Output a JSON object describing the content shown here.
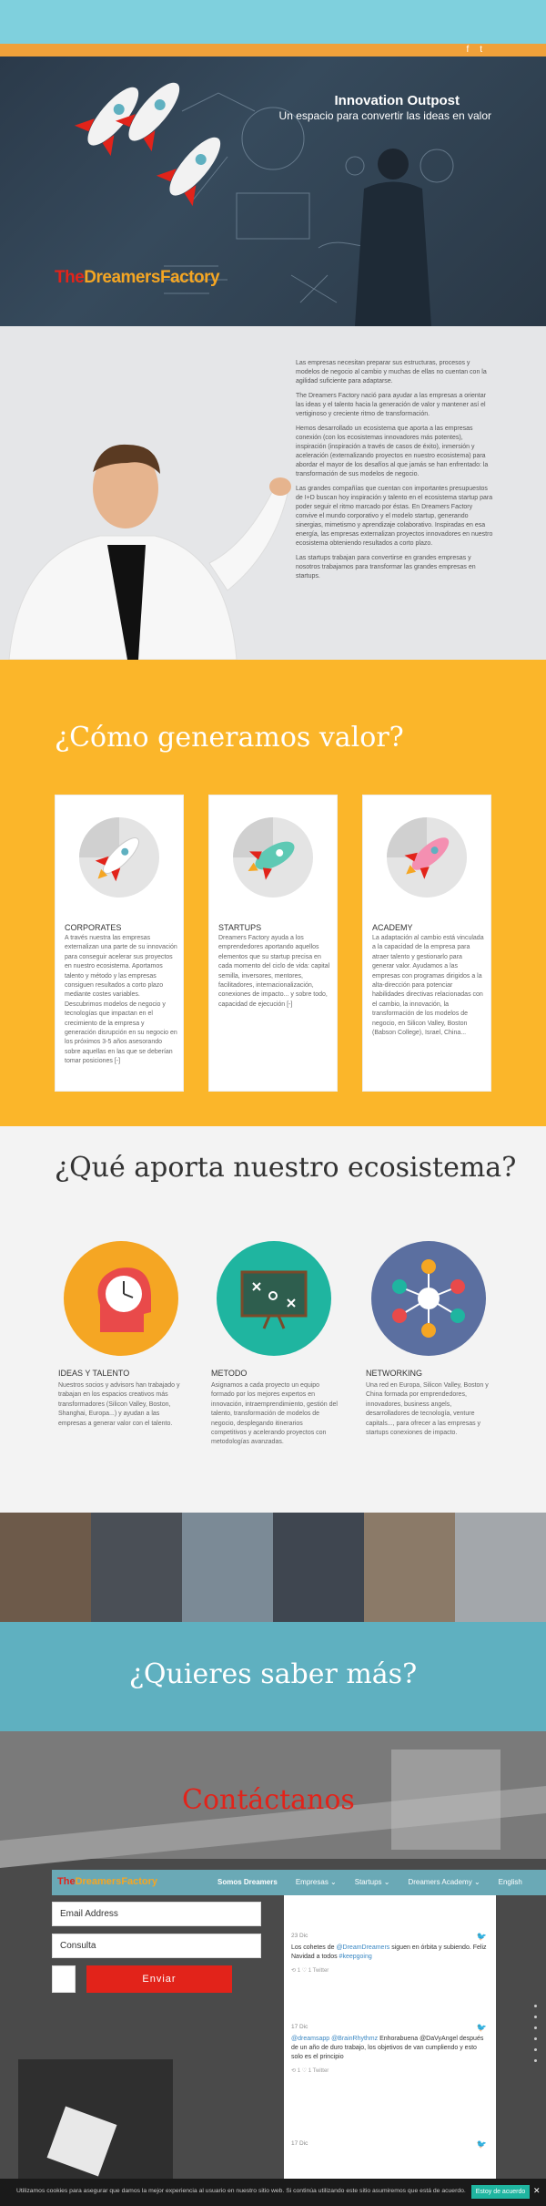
{
  "header": {
    "social": [
      "f",
      "t"
    ]
  },
  "hero": {
    "title": "Innovation Outpost",
    "subtitle": "Un espacio para convertir las ideas en valor",
    "logo_the": "The",
    "logo_rest": "DreamersFactory"
  },
  "intro": {
    "paragraphs": [
      "Las empresas necesitan preparar sus estructuras, procesos y modelos de negocio al cambio y muchas de ellas no cuentan con la agilidad suficiente para adaptarse.",
      "The Dreamers Factory nació para ayudar a las empresas a orientar las ideas y el talento hacia la generación de valor y mantener así el vertiginoso y creciente ritmo de transformación.",
      "Hemos desarrollado un ecosistema que aporta a las empresas conexión (con los ecosistemas innovadores más potentes), inspiración (inspiración a través de casos de éxito), inmersión y aceleración (externalizando proyectos en nuestro ecosistema) para abordar el mayor de los desafíos al que jamás se han enfrentado: la transformación de sus modelos de negocio.",
      "Las grandes compañías que cuentan con importantes presupuestos de I+D buscan hoy inspiración y talento en el ecosistema startup para poder seguir el ritmo marcado por éstas. En Dreamers Factory convive el mundo corporativo y el modelo startup, generando sinergias, mimetismo y aprendizaje colaborativo. Inspiradas en esa energía, las empresas externalizan proyectos innovadores en nuestro ecosistema obteniendo resultados a corto plazo.",
      "Las startups trabajan para convertirse en grandes empresas y nosotros trabajamos para transformar las grandes empresas en startups."
    ]
  },
  "value": {
    "title": "¿Cómo generamos valor?",
    "cards": [
      {
        "title": "CORPORATES",
        "text": "A través nuestra las empresas externalizan una parte de su innovación para conseguir acelerar sus proyectos en nuestro ecosistema. Aportamos talento y método y las empresas consiguen resultados a corto plazo mediante costes variables. Descubrimos modelos de negocio y tecnologías que impactan en el crecimiento de la empresa y generación disrupción en su negocio en los próximos 3-5 años asesorando sobre aquellas en las que se deberían tomar posiciones [-]"
      },
      {
        "title": "STARTUPS",
        "text": "Dreamers Factory ayuda a los emprendedores aportando aquellos elementos que su startup precisa en cada momento del ciclo de vida: capital semilla, inversores, mentores, facilitadores, internacionalización, conexiones de impacto... y sobre todo, capacidad de ejecución [-]"
      },
      {
        "title": "ACADEMY",
        "text": "La adaptación al cambio está vinculada a la capacidad de la empresa para atraer talento y gestionarlo para generar valor. Ayudamos a las empresas con programas dirigidos a la alta-dirección para potenciar habilidades directivas relacionadas con el cambio, la innovación, la transformación de los modelos de negocio, en Silicon Valley, Boston (Babson College), Israel, China..."
      }
    ]
  },
  "ecosystem": {
    "title": "¿Qué aporta nuestro ecosistema?",
    "features": [
      {
        "title": "IDEAS Y TALENTO",
        "text": "Nuestros socios y advisors han trabajado y trabajan en los espacios creativos más transformadores (Silicon Valley, Boston, Shanghai, Europa...) y ayudan a las empresas a generar valor con el talento."
      },
      {
        "title": "METODO",
        "text": "Asignamos a cada proyecto un equipo formado por los mejores expertos en innovación, intraemprendimiento, gestión del talento, transformación de modelos de negocio, desplegando itinerarios competitivos y acelerando proyectos con metodologías avanzadas."
      },
      {
        "title": "NETWORKING",
        "text": "Una red en Europa, Silicon Valley, Boston y China formada por emprendedores, innovadores, business angels, desarrolladores de tecnología, venture capitals..., para ofrecer a las empresas y startups conexiones de impacto."
      }
    ]
  },
  "more": {
    "title": "¿Quieres saber más?"
  },
  "contact": {
    "title": "Contáctanos",
    "nav_brand_the": "The",
    "nav_brand_rest": "DreamersFactory",
    "menu": [
      "Somos Dreamers",
      "Empresas ⌄",
      "Startups ⌄",
      "Dreamers Academy ⌄",
      "English"
    ],
    "email_placeholder": "Email Address",
    "message_placeholder": "Consulta",
    "send_label": "Enviar",
    "tweets": [
      {
        "time": "23 Dic",
        "text_a": "Los cohetes de ",
        "link": "@DreamDreamers",
        "text_b": " siguen en órbita y subiendo. Feliz Navidad a todos ",
        "tag": "#keepgoing",
        "meta": "⟲ 1   ♡ 1   Twitter"
      },
      {
        "time": "17 Dic",
        "text_a": "",
        "link": "@dreamsapp @BrainRhythmz",
        "text_b": " Enhorabuena @DaVyAngel después de un año de duro trabajo, los objetivos de van cumpliendo y esto solo es el principio",
        "tag": "",
        "meta": "⟲ 1   ♡ 1   Twitter"
      },
      {
        "time": "17 Dic",
        "text_a": "",
        "link": "",
        "text_b": "",
        "tag": "",
        "meta": ""
      }
    ]
  },
  "cookie": {
    "message": "Utilizamos cookies para asegurar que damos la mejor experiencia al usuario en nuestro sitio web. Si continúa utilizando este sitio asumiremos que está de acuerdo.",
    "accept": "Estoy de acuerdo",
    "close": "✕"
  }
}
